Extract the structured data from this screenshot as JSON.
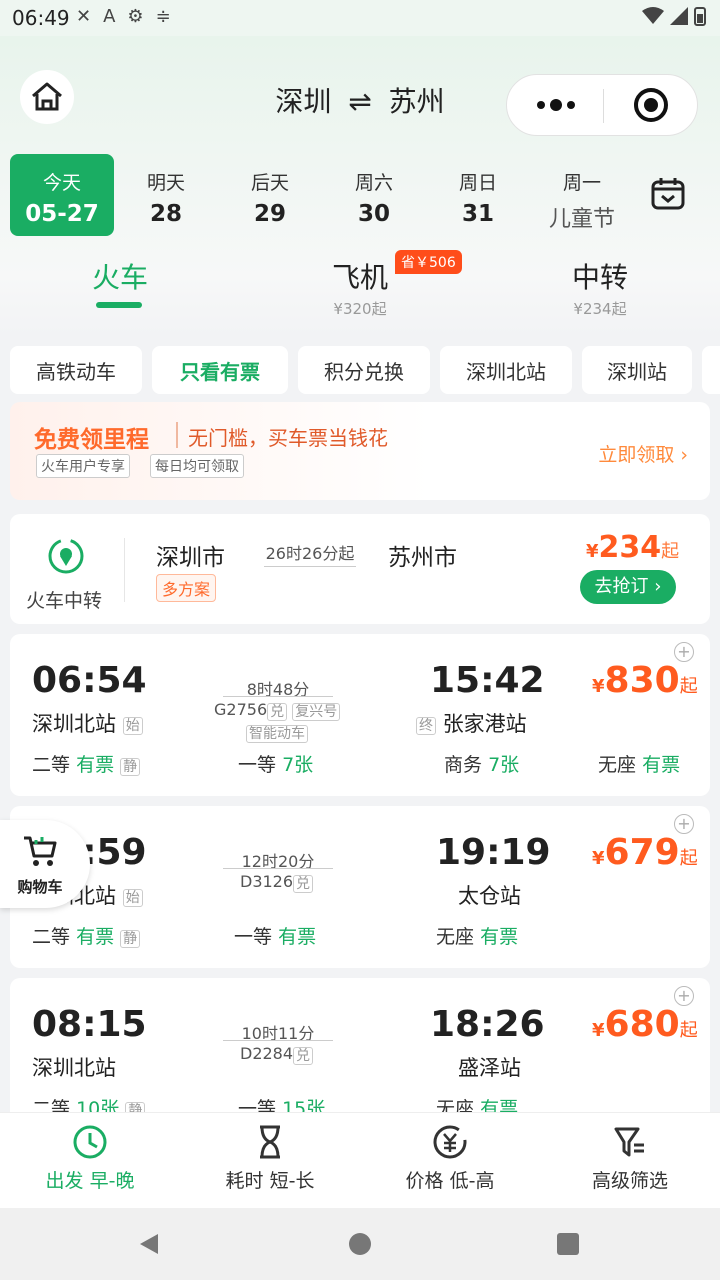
{
  "status": {
    "time": "06:49"
  },
  "header": {
    "from": "深圳",
    "swap": "⇌",
    "to": "苏州"
  },
  "dates": [
    {
      "week": "今天",
      "day": "05-27",
      "active": true
    },
    {
      "week": "明天",
      "day": "28"
    },
    {
      "week": "后天",
      "day": "29"
    },
    {
      "week": "周六",
      "day": "30"
    },
    {
      "week": "周日",
      "day": "31"
    },
    {
      "week": "周一",
      "day": "儿童节"
    }
  ],
  "modes": [
    {
      "name": "火车",
      "price": ""
    },
    {
      "name": "飞机",
      "price": "¥320起",
      "tag": "省￥506"
    },
    {
      "name": "中转",
      "price": "¥234起"
    }
  ],
  "chips": [
    "高铁动车",
    "只看有票",
    "积分兑换",
    "深圳北站",
    "深圳站"
  ],
  "promo": {
    "title": "免费领里程",
    "desc": "无门槛，买车票当钱花",
    "tags": [
      "火车用户专享",
      "每日均可领取"
    ],
    "link": "立即领取 ›"
  },
  "transfer": {
    "label": "火车中转",
    "from": "深圳市",
    "to": "苏州市",
    "duration": "26时26分起",
    "tag": "多方案",
    "price_sym": "¥",
    "price": "234",
    "price_suffix": "起",
    "button": "去抢订 ›"
  },
  "trains": [
    {
      "dep_time": "06:54",
      "dep_station": "深圳北站",
      "dep_tag": "始",
      "arr_time": "15:42",
      "arr_station": "张家港站",
      "arr_tag": "终",
      "duration": "8时48分",
      "code": "G2756",
      "code_tag": "兑",
      "extra1": "复兴号",
      "extra2": "智能动车",
      "price": "830",
      "seats": [
        {
          "name": "二等",
          "status": "有票",
          "tag": "静"
        },
        {
          "name": "一等",
          "status": "7张"
        },
        {
          "name": "商务",
          "status": "7张"
        },
        {
          "name": "无座",
          "status": "有票"
        }
      ]
    },
    {
      "dep_time": "07:59",
      "dep_station": "深圳北站",
      "dep_tag": "始",
      "arr_time": "19:19",
      "arr_station": "太仓站",
      "duration": "12时20分",
      "code": "D3126",
      "code_tag": "兑",
      "price": "679",
      "seats": [
        {
          "name": "二等",
          "status": "有票",
          "tag": "静"
        },
        {
          "name": "一等",
          "status": "有票"
        },
        {
          "name": "无座",
          "status": "有票"
        }
      ]
    },
    {
      "dep_time": "08:15",
      "dep_station": "深圳北站",
      "arr_time": "18:26",
      "arr_station": "盛泽站",
      "duration": "10时11分",
      "code": "D2284",
      "code_tag": "兑",
      "price": "680",
      "seats": [
        {
          "name": "二等",
          "status": "10张",
          "tag": "静"
        },
        {
          "name": "一等",
          "status": "15张"
        },
        {
          "name": "无座",
          "status": "有票"
        }
      ]
    }
  ],
  "price_sym": "¥",
  "price_suffix": "起",
  "cart": {
    "label": "购物车"
  },
  "bottom_tabs": [
    {
      "label": "出发 早-晚",
      "active": true
    },
    {
      "label": "耗时 短-长"
    },
    {
      "label": "价格 低-高"
    },
    {
      "label": "高级筛选"
    }
  ],
  "colors": {
    "accent": "#1aad63",
    "price": "#ff5b1f",
    "promo": "#ff6a2c"
  }
}
